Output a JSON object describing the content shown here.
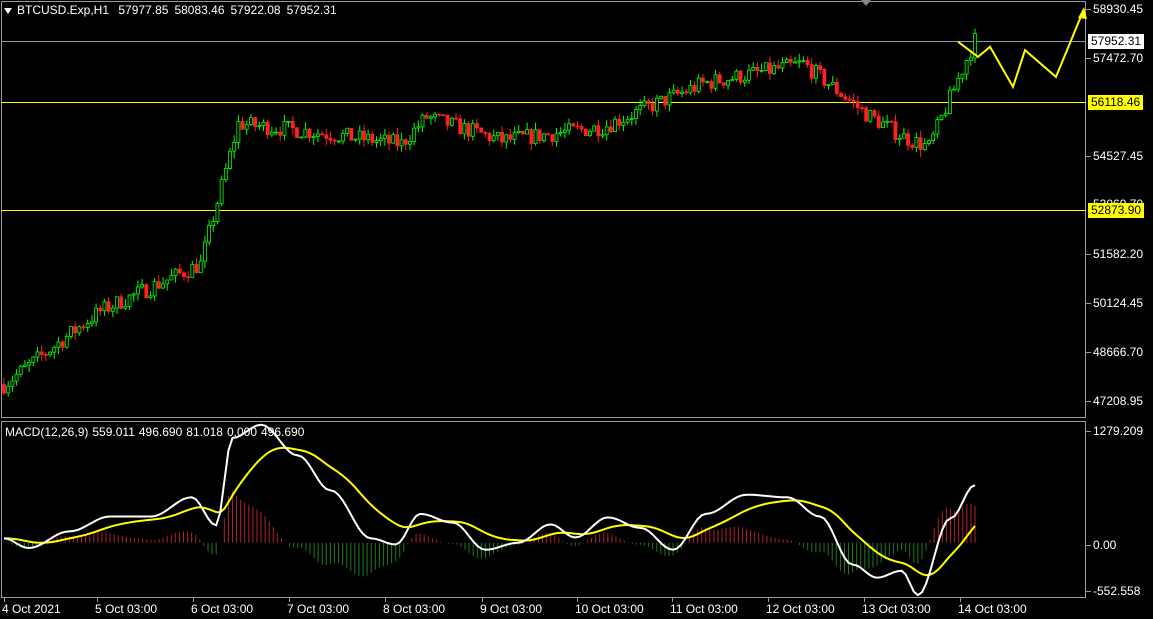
{
  "header": {
    "symbol_tf": "BTCUSD.Exp,H1",
    "open": "57977.85",
    "high": "58083.46",
    "low": "57922.08",
    "close": "57952.31"
  },
  "price_axis": {
    "labels": [
      "58930.45",
      "57472.70",
      "54527.45",
      "53069.70",
      "51582.20",
      "50124.45",
      "48666.70",
      "47208.95"
    ],
    "current_price": "57952.31",
    "level_1": "56118.46",
    "level_2": "52873.90"
  },
  "macd": {
    "label": "MACD(12,26,9)",
    "values": [
      "559.011",
      "496.690",
      "81.018",
      "0.000",
      "496.690"
    ],
    "axis_labels": [
      "1279.209",
      "0.00",
      "-552.558"
    ]
  },
  "time_axis": [
    "4 Oct 2021",
    "5 Oct 03:00",
    "6 Oct 03:00",
    "7 Oct 03:00",
    "8 Oct 03:00",
    "9 Oct 03:00",
    "10 Oct 03:00",
    "11 Oct 03:00",
    "12 Oct 03:00",
    "13 Oct 03:00",
    "14 Oct 03:00"
  ],
  "colors": {
    "bull": "#00ff00",
    "bear": "#ff2020",
    "level": "#ffff00",
    "price_line": "#8a9ab0",
    "macd_line": "#ffffff",
    "signal_line": "#ffff00",
    "hist_up": "#b22222",
    "hist_down": "#1f7a1f"
  },
  "chart_data": {
    "type": "candlestick",
    "x_range": [
      "4 Oct 2021",
      "14 Oct 03:00"
    ],
    "ylim": [
      47208.95,
      58930.45
    ],
    "close_path": [
      [
        "4 Oct 2021",
        47700
      ],
      [
        "5 Oct 03:00",
        49900
      ],
      [
        "6 Oct 03:00",
        51300
      ],
      [
        "6 Oct 12:00",
        55500
      ],
      [
        "7 Oct 03:00",
        55300
      ],
      [
        "8 Oct 03:00",
        54900
      ],
      [
        "8 Oct 09:00",
        55700
      ],
      [
        "9 Oct 03:00",
        55000
      ],
      [
        "10 Oct 03:00",
        55400
      ],
      [
        "11 Oct 03:00",
        56700
      ],
      [
        "12 Oct 03:00",
        57300
      ],
      [
        "12 Oct 18:00",
        55800
      ],
      [
        "13 Oct 03:00",
        55100
      ],
      [
        "13 Oct 12:00",
        54800
      ],
      [
        "14 Oct 03:00",
        58000
      ]
    ],
    "levels": [
      56118.46,
      52873.9
    ],
    "current_price": 57952.31,
    "forecast_path": [
      57952.31,
      57500,
      57800,
      56600,
      57700,
      56900,
      58930.45
    ],
    "macd": {
      "ylim": [
        -552.558,
        1279.209
      ],
      "main": 559.011,
      "signal": 496.69
    }
  }
}
